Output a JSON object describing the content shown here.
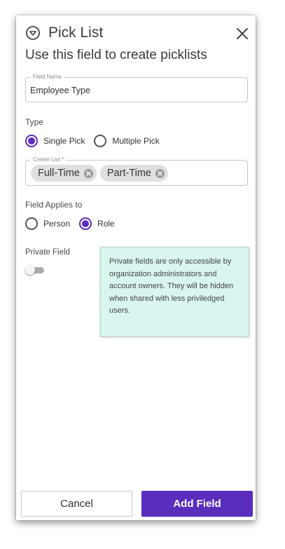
{
  "header": {
    "icon": "chevron-down-circle-icon",
    "title": "Pick List",
    "subtitle": "Use this field to create picklists"
  },
  "field_name": {
    "label": "Field Name",
    "value": "Employee Type"
  },
  "type": {
    "label": "Type",
    "options": [
      {
        "label": "Single Pick",
        "checked": true
      },
      {
        "label": "Multiple Pick",
        "checked": false
      }
    ]
  },
  "create_list": {
    "label": "Create List *",
    "chips": [
      "Full-Time",
      "Part-Time"
    ]
  },
  "applies_to": {
    "label": "Field Applies to",
    "options": [
      {
        "label": "Person",
        "checked": false
      },
      {
        "label": "Role",
        "checked": true
      }
    ]
  },
  "private_field": {
    "label": "Private Field",
    "enabled": false,
    "info": "Private fields are only accessible by organization administrators and account owners. They will be hidden when shared with less priviledged users."
  },
  "buttons": {
    "cancel": "Cancel",
    "add": "Add Field"
  },
  "colors": {
    "accent": "#5b2dbd",
    "info_bg": "#d8f5ef"
  }
}
